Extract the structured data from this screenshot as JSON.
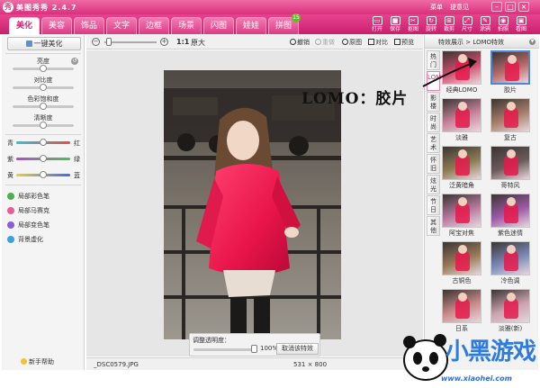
{
  "app": {
    "title": "美图秀秀 2.4.7",
    "logo": "秀",
    "menu": "菜单",
    "help": "提意见"
  },
  "tabs": [
    {
      "label": "美化",
      "active": true
    },
    {
      "label": "美容"
    },
    {
      "label": "饰品"
    },
    {
      "label": "文字"
    },
    {
      "label": "边框"
    },
    {
      "label": "场景"
    },
    {
      "label": "闪图"
    },
    {
      "label": "娃娃"
    },
    {
      "label": "拼图",
      "badge": "15"
    }
  ],
  "toolbar": [
    {
      "label": "打开",
      "icon": "folder-icon"
    },
    {
      "label": "保存",
      "icon": "save-icon"
    },
    {
      "label": "抠图",
      "icon": "crop-icon"
    },
    {
      "label": "旋转",
      "icon": "rotate-icon"
    },
    {
      "label": "裁剪",
      "icon": "cut-icon"
    },
    {
      "label": "尺寸",
      "icon": "resize-icon"
    },
    {
      "label": "涂鸦",
      "icon": "brush-icon"
    },
    {
      "label": "拍照",
      "icon": "camera-icon"
    },
    {
      "label": "看图",
      "icon": "image-icon"
    }
  ],
  "left": {
    "one_key": "一键美化",
    "sliders": [
      {
        "label": "亮度",
        "value": 0.5
      },
      {
        "label": "对比度",
        "value": 0.5
      },
      {
        "label": "色彩饱和度",
        "value": 0.5
      },
      {
        "label": "清晰度",
        "value": 0.5
      }
    ],
    "color_balance": [
      {
        "left": "青",
        "right": "红",
        "value": 0.5,
        "gradient": [
          "#31c2d9",
          "#e84a4a"
        ]
      },
      {
        "left": "紫",
        "right": "绿",
        "value": 0.5,
        "gradient": [
          "#b34ad8",
          "#4ac44a"
        ]
      },
      {
        "left": "黄",
        "right": "蓝",
        "value": 0.5,
        "gradient": [
          "#e8d03a",
          "#3a6ee8"
        ]
      }
    ],
    "tools": [
      {
        "label": "局部彩色笔",
        "color": "#4caf50"
      },
      {
        "label": "局部马赛克",
        "color": "#e65c9a"
      },
      {
        "label": "局部变色笔",
        "color": "#8a5cd8"
      },
      {
        "label": "背景虚化",
        "color": "#3aa0e0"
      }
    ],
    "help": "新手帮助"
  },
  "canvas_toolbar": {
    "zoom_ratio": "1:1",
    "zoom_label": "原大",
    "undo": "撤销",
    "redo": "重做",
    "original": "原图",
    "compare": "对比",
    "preview": "预览"
  },
  "opacity": {
    "label": "调整透明度：",
    "value": "100%",
    "cancel": "取消该特效",
    "level": 1.0
  },
  "status": {
    "filename": "_DSC0579.JPG",
    "dims": "531 × 800"
  },
  "right": {
    "breadcrumb": "特效展示 > LOMO特效",
    "vtabs": [
      "热门",
      "LOMO",
      "影楼",
      "时尚",
      "艺术",
      "怀旧",
      "炫光",
      "节日",
      "其他"
    ],
    "effects": [
      {
        "name": "经典LOMO"
      },
      {
        "name": "胶片",
        "selected": true
      },
      {
        "name": "淡雅"
      },
      {
        "name": "复古"
      },
      {
        "name": "泛黄暗角"
      },
      {
        "name": "哥特风"
      },
      {
        "name": "阿宝对焦"
      },
      {
        "name": "紫色迷情"
      },
      {
        "name": "古铜色"
      },
      {
        "name": "冷色调"
      },
      {
        "name": "日系"
      },
      {
        "name": "淡雅(新)"
      }
    ]
  },
  "annotation": "LOMO：胶片",
  "watermark": {
    "brand": "小黑游戏",
    "site": "www.xiaohei.com"
  }
}
